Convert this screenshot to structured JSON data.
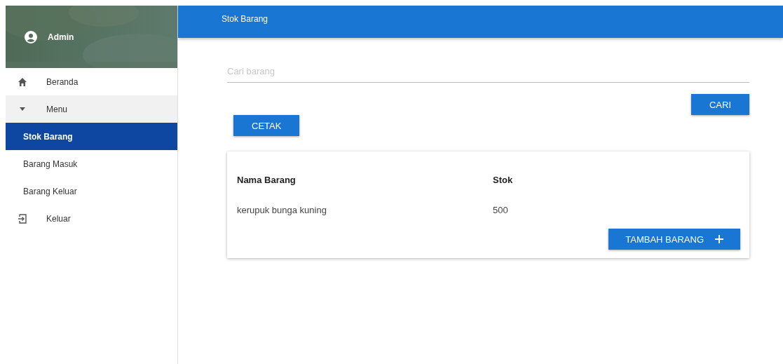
{
  "sidebar": {
    "user": {
      "name": "Admin"
    },
    "items": [
      {
        "kind": "home",
        "label": "Beranda"
      },
      {
        "kind": "group",
        "label": "Menu",
        "expanded": true,
        "children": [
          {
            "label": "Stok Barang",
            "selected": true
          },
          {
            "label": "Barang Masuk",
            "selected": false
          },
          {
            "label": "Barang Keluar",
            "selected": false
          }
        ]
      },
      {
        "kind": "exit",
        "label": "Keluar"
      }
    ]
  },
  "app_bar": {
    "title": "Stok Barang"
  },
  "search": {
    "placeholder": "Cari barang",
    "button": "CARI"
  },
  "print_button": "CETAK",
  "table": {
    "columns": [
      "Nama Barang",
      "Stok"
    ],
    "rows": [
      [
        "kerupuk bunga kuning",
        "500"
      ]
    ],
    "add_button": "TAMBAH BARANG"
  }
}
